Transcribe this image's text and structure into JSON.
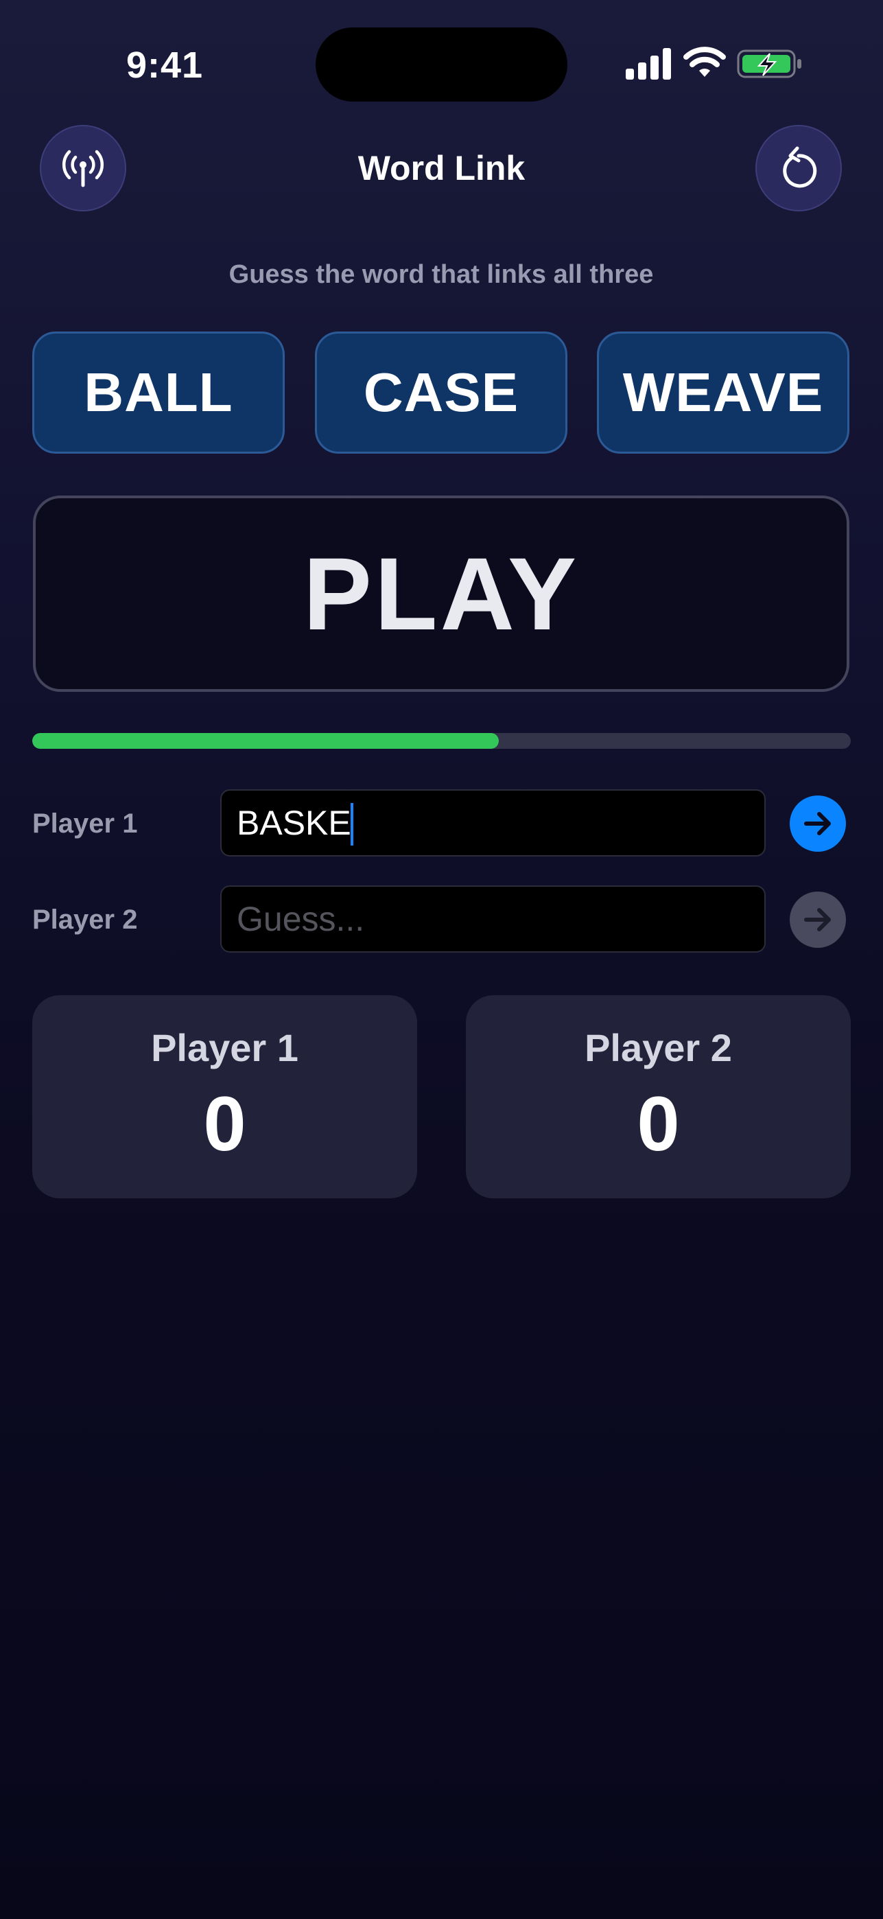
{
  "status_bar": {
    "time": "9:41"
  },
  "header": {
    "title": "Word Link",
    "left_icon": "broadcast-icon",
    "right_icon": "reset-icon"
  },
  "instructions": "Guess the word that links all three",
  "clues": [
    "BALL",
    "CASE",
    "WEAVE"
  ],
  "play_label": "PLAY",
  "timer": {
    "progress": 0.57,
    "color": "#33c759"
  },
  "guesses": [
    {
      "label": "Player 1",
      "value": "BASKE",
      "placeholder": "Guess...",
      "submit_color": "#0a84ff",
      "active": true
    },
    {
      "label": "Player 2",
      "value": "",
      "placeholder": "Guess...",
      "submit_color": "#4a4a5e",
      "active": false
    }
  ],
  "scores": [
    {
      "name": "Player 1",
      "score": "0"
    },
    {
      "name": "Player 2",
      "score": "0"
    }
  ],
  "colors": {
    "clue_tile": "#0f3567",
    "accent_blue": "#0a84ff",
    "progress_green": "#33c759"
  }
}
